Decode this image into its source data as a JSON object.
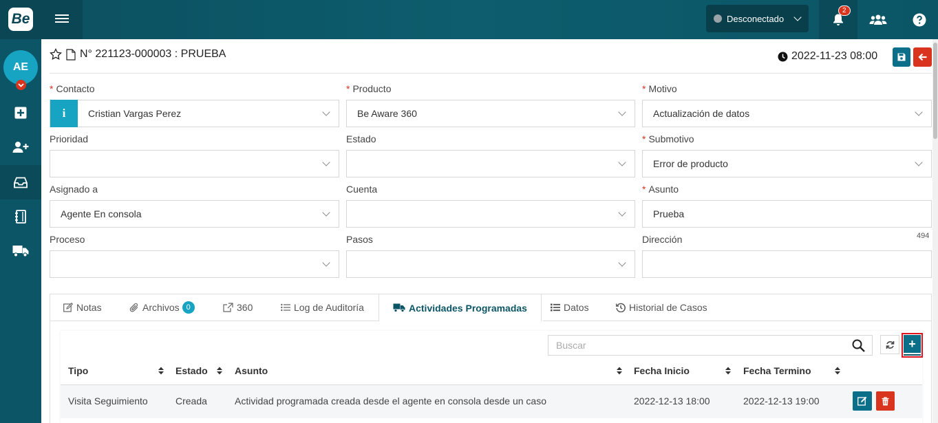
{
  "app": {
    "logo_text": "Be"
  },
  "topbar": {
    "status_label": "Desconectado",
    "notification_count": "2"
  },
  "sidebar": {
    "avatar_initials": "AE",
    "items": [
      {
        "icon": "plus-square-icon"
      },
      {
        "icon": "user-plus-icon"
      },
      {
        "icon": "inbox-icon"
      },
      {
        "icon": "notebook-icon"
      },
      {
        "icon": "truck-icon"
      }
    ]
  },
  "case": {
    "title": "N° 221123-000003 : PRUEBA",
    "datetime": "2022-11-23 08:00"
  },
  "form": {
    "contacto": {
      "label": "Contacto",
      "value": "Cristian Vargas Perez"
    },
    "producto": {
      "label": "Producto",
      "value": "Be Aware 360"
    },
    "motivo": {
      "label": "Motivo",
      "value": "Actualización de datos"
    },
    "prioridad": {
      "label": "Prioridad",
      "value": ""
    },
    "estado": {
      "label": "Estado",
      "value": ""
    },
    "submotivo": {
      "label": "Submotivo",
      "value": "Error de producto"
    },
    "asignado": {
      "label": "Asignado a",
      "value": "Agente En consola"
    },
    "cuenta": {
      "label": "Cuenta",
      "value": ""
    },
    "asunto": {
      "label": "Asunto",
      "value": "Prueba",
      "counter": "494"
    },
    "proceso": {
      "label": "Proceso",
      "value": ""
    },
    "pasos": {
      "label": "Pasos",
      "value": ""
    },
    "direccion": {
      "label": "Dirección",
      "value": ""
    }
  },
  "tabs": {
    "notas": "Notas",
    "archivos": "Archivos",
    "archivos_count": "0",
    "t360": "360",
    "log": "Log de Auditoría",
    "actividades": "Actividades Programadas",
    "datos": "Datos",
    "historial": "Historial de Casos"
  },
  "activities": {
    "search_placeholder": "Buscar",
    "add_label": "+",
    "columns": [
      "Tipo",
      "Estado",
      "Asunto",
      "Fecha Inicio",
      "Fecha Termino"
    ],
    "rows": [
      {
        "tipo": "Visita Seguimiento",
        "estado": "Creada",
        "asunto": "Actividad programada creada desde el agente en consola desde un caso",
        "fecha_inicio": "2022-12-13 18:00",
        "fecha_termino": "2022-12-13 19:00"
      }
    ]
  },
  "colors": {
    "topbar": "#0d5d6e",
    "sidebar": "#0c5566",
    "accent": "#17a3c2",
    "primary_button": "#0c6f8a",
    "danger": "#d9341e"
  }
}
